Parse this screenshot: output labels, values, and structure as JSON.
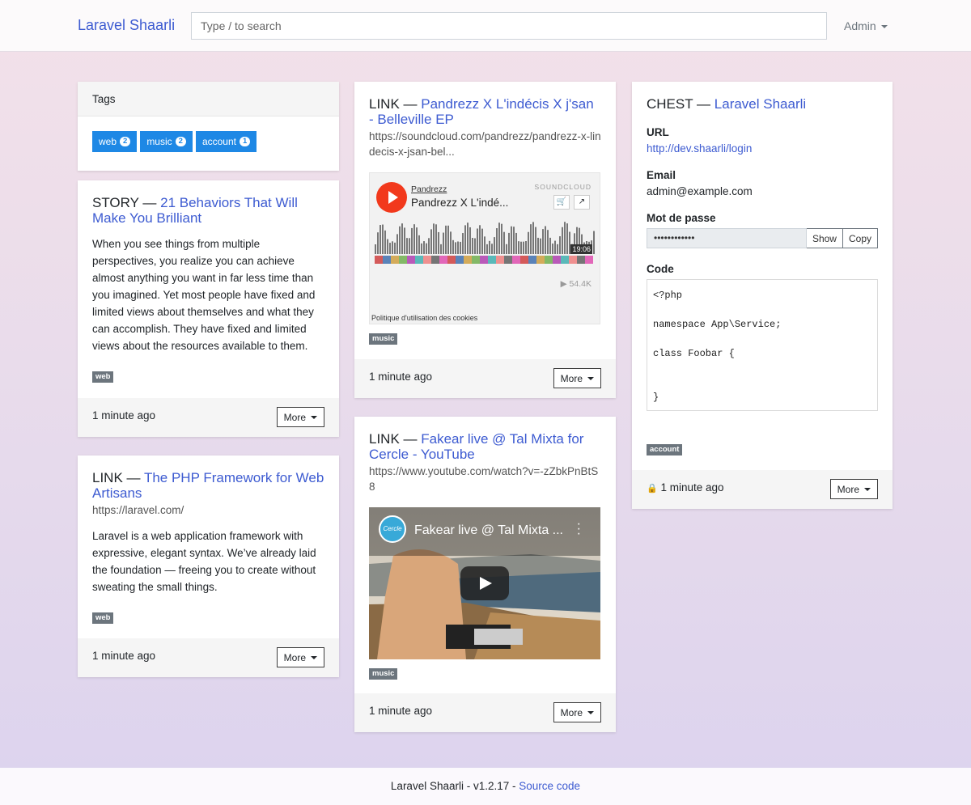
{
  "navbar": {
    "brand": "Laravel Shaarli",
    "search_placeholder": "Type / to search",
    "user_menu": "Admin"
  },
  "tags_card": {
    "header": "Tags",
    "tags": [
      {
        "label": "web",
        "count": "2"
      },
      {
        "label": "music",
        "count": "2"
      },
      {
        "label": "account",
        "count": "1"
      }
    ]
  },
  "cards": {
    "story": {
      "type": "STORY —",
      "title": "21 Behaviors That Will Make You Brilliant",
      "text": "When you see things from multiple perspectives, you realize you can achieve almost anything you want in far less time than you imagined. Yet most people have fixed and limited views about themselves and what they can accomplish. They have fixed and limited views about the resources available to them.",
      "tag": "web",
      "ago": "1 minute ago",
      "more": "More"
    },
    "laravel": {
      "type": "LINK —",
      "title": "The PHP Framework for Web Artisans",
      "url": "https://laravel.com/",
      "text": "Laravel is a web application framework with expressive, elegant syntax. We’ve already laid the foundation — freeing you to create without sweating the small things.",
      "tag": "web",
      "ago": "1 minute ago",
      "more": "More"
    },
    "soundcloud": {
      "type": "LINK —",
      "title": "Pandrezz X L'indécis X j'san - Belleville EP",
      "url": "https://soundcloud.com/pandrezz/pandrezz-x-lindecis-x-jsan-bel...",
      "embed": {
        "user": "Pandrezz",
        "track": "Pandrezz X L'indé...",
        "logo": "SOUNDCLOUD",
        "duration": "19:06",
        "plays": "▶ 54.4K",
        "cookie": "Politique d'utilisation des cookies"
      },
      "tag": "music",
      "ago": "1 minute ago",
      "more": "More"
    },
    "youtube": {
      "type": "LINK —",
      "title": "Fakear live @ Tal Mixta for Cercle - YouTube",
      "url": "https://www.youtube.com/watch?v=-zZbkPnBtS8",
      "embed": {
        "title": "Fakear live @ Tal Mixta ...",
        "channel": "Cercle"
      },
      "tag": "music",
      "ago": "1 minute ago",
      "more": "More"
    },
    "chest": {
      "type": "CHEST —",
      "title": "Laravel Shaarli",
      "url_label": "URL",
      "url_value": "http://dev.shaarli/login",
      "email_label": "Email",
      "email_value": "admin@example.com",
      "password_label": "Mot de passe",
      "password_value": "••••••••••••",
      "show": "Show",
      "copy": "Copy",
      "code_label": "Code",
      "code": "<?php\n\nnamespace App\\Service;\n\nclass Foobar {\n\n\n}",
      "tag": "account",
      "ago": "1 minute ago",
      "lock": "🔒",
      "more": "More"
    }
  },
  "footer": {
    "text": "Laravel Shaarli - v1.2.17 -",
    "link": "Source code"
  },
  "colors": {
    "link": "#3d5bd1",
    "tag_button": "#1e88e5",
    "badge": "#6c757d",
    "soundcloud": "#f2391c"
  }
}
